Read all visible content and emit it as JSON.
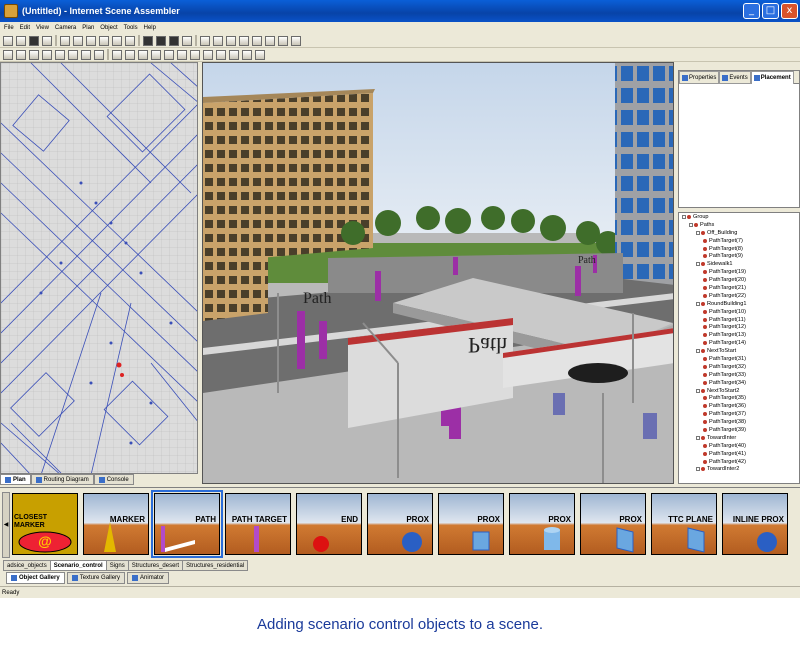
{
  "window": {
    "title": "(Untitled) - Internet Scene Assembler",
    "buttons": [
      "_",
      "□",
      "x"
    ]
  },
  "menu": [
    "File",
    "Edit",
    "View",
    "Camera",
    "Plan",
    "Object",
    "Tools",
    "Help"
  ],
  "left_tabs": [
    "Plan",
    "Routing Diagram",
    "Console"
  ],
  "props_tabs": [
    "Properties",
    "Events",
    "Placement"
  ],
  "tree": [
    {
      "label": "Group",
      "indent": 0,
      "kind": "box"
    },
    {
      "label": "Paths",
      "indent": 1,
      "kind": "box"
    },
    {
      "label": "Off_Building",
      "indent": 2,
      "kind": "box"
    },
    {
      "label": "PathTarget(7)",
      "indent": 3,
      "kind": "dot"
    },
    {
      "label": "PathTarget(8)",
      "indent": 3,
      "kind": "dot"
    },
    {
      "label": "PathTarget(9)",
      "indent": 3,
      "kind": "dot"
    },
    {
      "label": "Sidewalk1",
      "indent": 2,
      "kind": "box"
    },
    {
      "label": "PathTarget(19)",
      "indent": 3,
      "kind": "dot"
    },
    {
      "label": "PathTarget(20)",
      "indent": 3,
      "kind": "dot"
    },
    {
      "label": "PathTarget(21)",
      "indent": 3,
      "kind": "dot"
    },
    {
      "label": "PathTarget(22)",
      "indent": 3,
      "kind": "dot"
    },
    {
      "label": "RoundBuilding1",
      "indent": 2,
      "kind": "box"
    },
    {
      "label": "PathTarget(10)",
      "indent": 3,
      "kind": "dot"
    },
    {
      "label": "PathTarget(11)",
      "indent": 3,
      "kind": "dot"
    },
    {
      "label": "PathTarget(12)",
      "indent": 3,
      "kind": "dot"
    },
    {
      "label": "PathTarget(13)",
      "indent": 3,
      "kind": "dot"
    },
    {
      "label": "PathTarget(14)",
      "indent": 3,
      "kind": "dot"
    },
    {
      "label": "NextToStart",
      "indent": 2,
      "kind": "box"
    },
    {
      "label": "PathTarget(31)",
      "indent": 3,
      "kind": "dot"
    },
    {
      "label": "PathTarget(32)",
      "indent": 3,
      "kind": "dot"
    },
    {
      "label": "PathTarget(33)",
      "indent": 3,
      "kind": "dot"
    },
    {
      "label": "PathTarget(34)",
      "indent": 3,
      "kind": "dot"
    },
    {
      "label": "NextToStart2",
      "indent": 2,
      "kind": "box"
    },
    {
      "label": "PathTarget(35)",
      "indent": 3,
      "kind": "dot"
    },
    {
      "label": "PathTarget(36)",
      "indent": 3,
      "kind": "dot"
    },
    {
      "label": "PathTarget(37)",
      "indent": 3,
      "kind": "dot"
    },
    {
      "label": "PathTarget(38)",
      "indent": 3,
      "kind": "dot"
    },
    {
      "label": "PathTarget(39)",
      "indent": 3,
      "kind": "dot"
    },
    {
      "label": "TowardInter",
      "indent": 2,
      "kind": "box"
    },
    {
      "label": "PathTarget(40)",
      "indent": 3,
      "kind": "dot"
    },
    {
      "label": "PathTarget(41)",
      "indent": 3,
      "kind": "dot"
    },
    {
      "label": "PathTarget(42)",
      "indent": 3,
      "kind": "dot"
    },
    {
      "label": "TowardInter2",
      "indent": 2,
      "kind": "box"
    }
  ],
  "viewport": {
    "path_labels": [
      "Path",
      "Path",
      "Path"
    ]
  },
  "gallery": {
    "items": [
      {
        "label": "CLOSEST MARKER",
        "shape": "closest",
        "selected": false
      },
      {
        "label": "MARKER",
        "shape": "marker",
        "selected": false
      },
      {
        "label": "PATH",
        "shape": "path",
        "selected": true
      },
      {
        "label": "PATH TARGET",
        "shape": "pathtarget",
        "selected": false
      },
      {
        "label": "END",
        "shape": "end",
        "selected": false
      },
      {
        "label": "PROX",
        "shape": "sphere",
        "selected": false
      },
      {
        "label": "PROX",
        "shape": "cube",
        "selected": false
      },
      {
        "label": "PROX",
        "shape": "cylinder",
        "selected": false
      },
      {
        "label": "PROX",
        "shape": "plane",
        "selected": false
      },
      {
        "label": "TTC PLANE",
        "shape": "plane",
        "selected": false
      },
      {
        "label": "INLINE PROX",
        "shape": "sphere",
        "selected": false
      }
    ],
    "category_tabs": [
      "adsice_objects",
      "Scenario_control",
      "Signs",
      "Structures_desert",
      "Structures_residential"
    ],
    "active_category": "Scenario_control"
  },
  "bottom_tabs": [
    "Object Gallery",
    "Texture Gallery",
    "Animator"
  ],
  "status": "Ready",
  "caption": "Adding scenario control objects to a scene.",
  "colors": {
    "title_blue": "#0a52c8",
    "plan_lines": "#3a4fb8",
    "path_marker": "#9c2fa6",
    "caption_blue": "#1a3a9a"
  }
}
